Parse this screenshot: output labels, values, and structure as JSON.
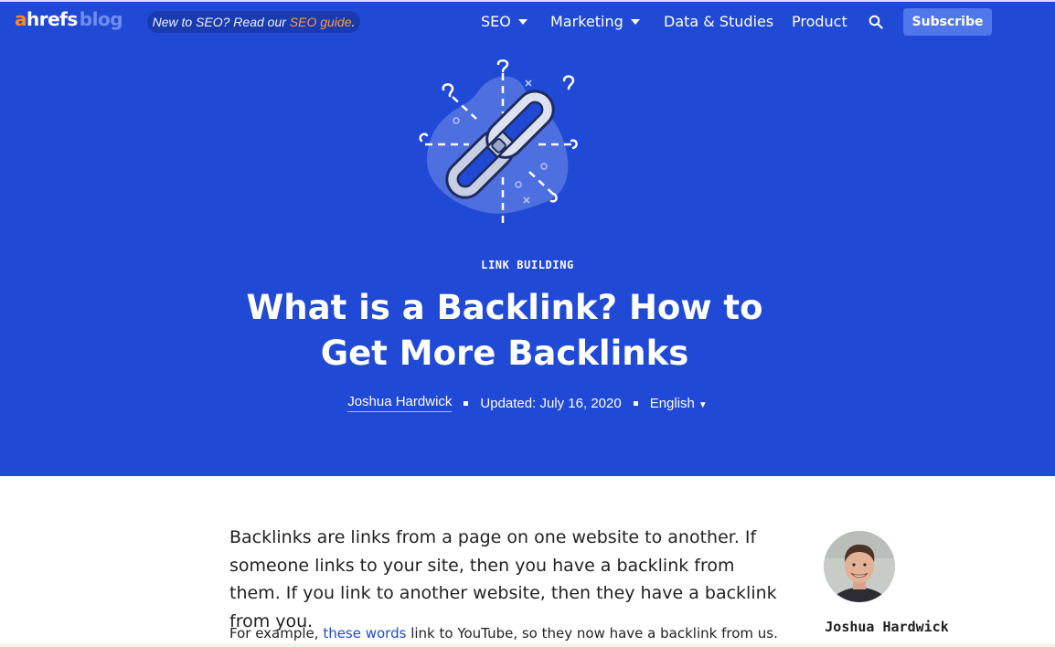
{
  "header": {
    "logo": {
      "a": "a",
      "hrefs": "hrefs",
      "blog": "blog"
    },
    "promo": {
      "text": "New to SEO? Read our ",
      "link": "SEO guide",
      "suffix": "."
    },
    "nav": [
      {
        "label": "SEO",
        "has_dropdown": true
      },
      {
        "label": "Marketing",
        "has_dropdown": true
      },
      {
        "label": "Data & Studies",
        "has_dropdown": false
      },
      {
        "label": "Product",
        "has_dropdown": false
      }
    ],
    "search_icon": "search-icon",
    "subscribe_label": "Subscribe"
  },
  "hero": {
    "illustration_icon": "chain-link-icon",
    "category": "LINK BUILDING",
    "title": "What is a Backlink? How to Get More Backlinks",
    "author": "Joshua Hardwick",
    "updated": "Updated: July 16, 2020",
    "language": "English"
  },
  "article": {
    "lead": "Backlinks are links from a page on one website to another. If someone links to your site, then you have a backlink from them. If you link to another website, then they have a backlink from you.",
    "para2_prefix": "For example, ",
    "para2_link": "these words",
    "para2_suffix": " link to YouTube, so they now have a backlink from us."
  },
  "sidebar": {
    "author_name": "Joshua Hardwick"
  },
  "colors": {
    "hero_bg": "#2049d6",
    "accent_orange": "#ff8a1d",
    "subscribe_bg": "#5077ea",
    "link": "#2049d6"
  }
}
